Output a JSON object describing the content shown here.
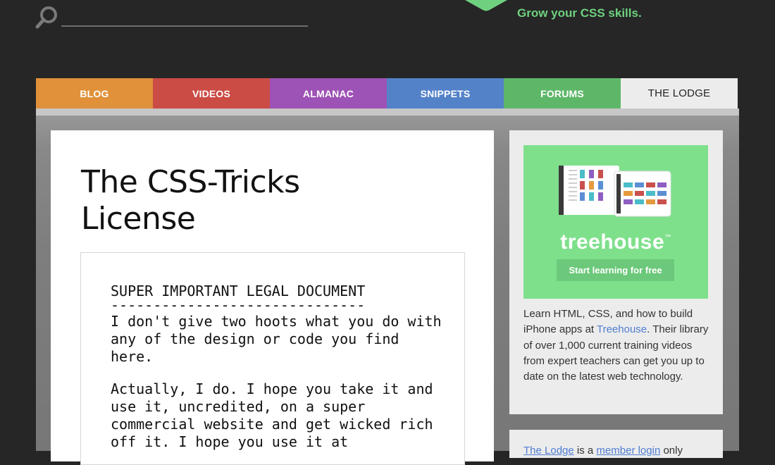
{
  "header": {
    "tagline": "Grow your CSS skills.",
    "search_icon": "search-icon",
    "logo_icon": "logo-icon"
  },
  "nav": {
    "tabs": [
      {
        "label": "BLOG",
        "color": "#e0913a"
      },
      {
        "label": "VIDEOS",
        "color": "#cb4b45"
      },
      {
        "label": "ALMANAC",
        "color": "#9d52b5"
      },
      {
        "label": "SNIPPETS",
        "color": "#5382c9"
      },
      {
        "label": "FORUMS",
        "color": "#5eb768"
      },
      {
        "label": "THE LODGE",
        "color": "#ececec",
        "active": true
      }
    ]
  },
  "main": {
    "title_line1": "The CSS-Tricks",
    "title_line2": "License",
    "license": {
      "heading": "SUPER IMPORTANT LEGAL DOCUMENT",
      "rule": "------------------------------",
      "para1": "I don't give two hoots what you do with any of the design or code you find here.",
      "para2": "Actually, I do. I hope you take it and use it, uncredited, on a super commercial website and get wicked rich off it. I hope you use it at"
    }
  },
  "sidebar": {
    "ad": {
      "brand": "treehouse",
      "trademark": "™",
      "cta": "Start learning for free",
      "desc_before": "Learn HTML, CSS, and how to build iPhone apps at ",
      "desc_link": "Treehouse",
      "desc_after": ". Their library of over 1,000 current training videos from expert teachers can get you up to date on the latest web technology."
    },
    "lodge_note": {
      "link1": "The Lodge",
      "middle": " is a ",
      "link2": "member login",
      "end": " only"
    }
  },
  "colors": {
    "background": "#262626",
    "accent_green": "#6fd17f",
    "ad_green": "#7fe08c",
    "link_blue": "#4f7dd1"
  }
}
